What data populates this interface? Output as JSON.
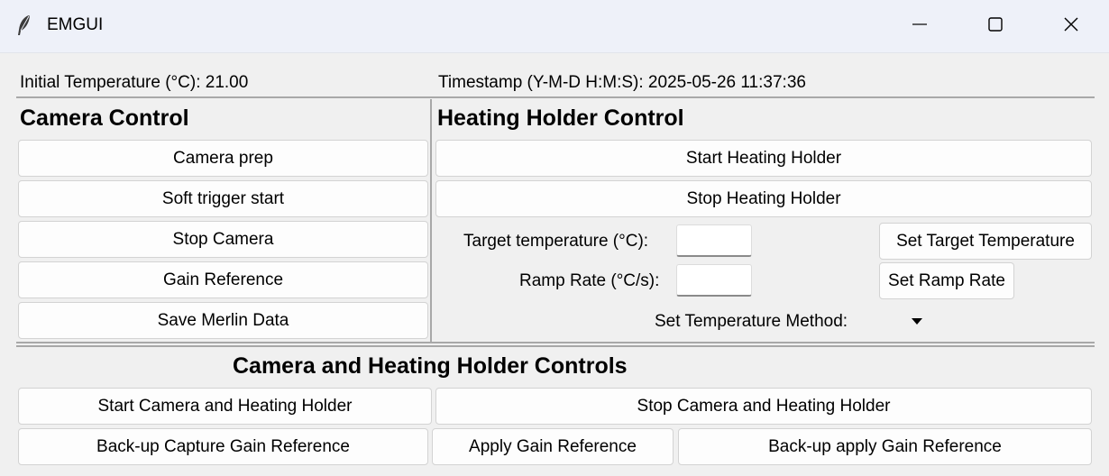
{
  "window": {
    "title": "EMGUI"
  },
  "status": {
    "initial_temp": "Initial Temperature (°C): 21.00",
    "timestamp": "Timestamp (Y-M-D H:M:S): 2025-05-26 11:37:36"
  },
  "camera_control": {
    "title": "Camera Control",
    "buttons": [
      "Camera prep",
      "Soft trigger start",
      "Stop Camera",
      "Gain Reference",
      "Save Merlin Data"
    ]
  },
  "heating_control": {
    "title": "Heating Holder Control",
    "start_label": "Start Heating Holder",
    "stop_label": "Stop Heating Holder",
    "target_temp_label": "Target temperature (°C):",
    "target_temp_value": "",
    "set_target_label": "Set Target Temperature",
    "ramp_rate_label": "Ramp Rate (°C/s):",
    "ramp_rate_value": "",
    "set_ramp_label": "Set Ramp Rate",
    "method_label": "Set Temperature Method:",
    "method_value": ""
  },
  "combined": {
    "title": "Camera and Heating Holder Controls",
    "start_both": "Start Camera and Heating Holder",
    "stop_both": "Stop Camera and Heating Holder",
    "backup_capture": "Back-up Capture Gain Reference",
    "apply_gain": "Apply Gain Reference",
    "backup_apply": "Back-up apply Gain Reference"
  }
}
